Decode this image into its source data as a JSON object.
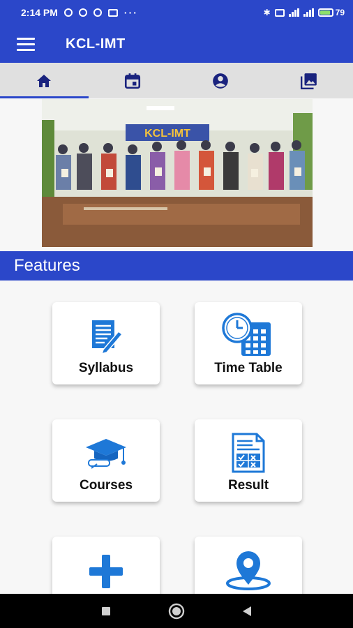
{
  "status_bar": {
    "time": "2:14 PM",
    "battery_percent": "79",
    "battery_level": 0.79
  },
  "app_bar": {
    "title": "KCL-IMT",
    "menu_icon": "hamburger-menu-icon"
  },
  "tabs": [
    {
      "icon": "home-icon",
      "active": true
    },
    {
      "icon": "calendar-icon",
      "active": false
    },
    {
      "icon": "account-circle-icon",
      "active": false
    },
    {
      "icon": "photo-gallery-icon",
      "active": false
    }
  ],
  "banner": {
    "sign_text": "KCL-IMT"
  },
  "features": {
    "heading": "Features",
    "cards": [
      {
        "label": "Syllabus",
        "icon": "document-pen-icon"
      },
      {
        "label": "Time Table",
        "icon": "clock-calendar-icon"
      },
      {
        "label": "Courses",
        "icon": "graduation-cap-icon"
      },
      {
        "label": "Result",
        "icon": "result-sheet-icon"
      },
      {
        "label": "",
        "icon": "plus-icon"
      },
      {
        "label": "",
        "icon": "location-pin-icon"
      }
    ]
  },
  "colors": {
    "primary": "#2b47c9",
    "icon_blue": "#1e78d7",
    "tab_icon": "#1a237e"
  }
}
